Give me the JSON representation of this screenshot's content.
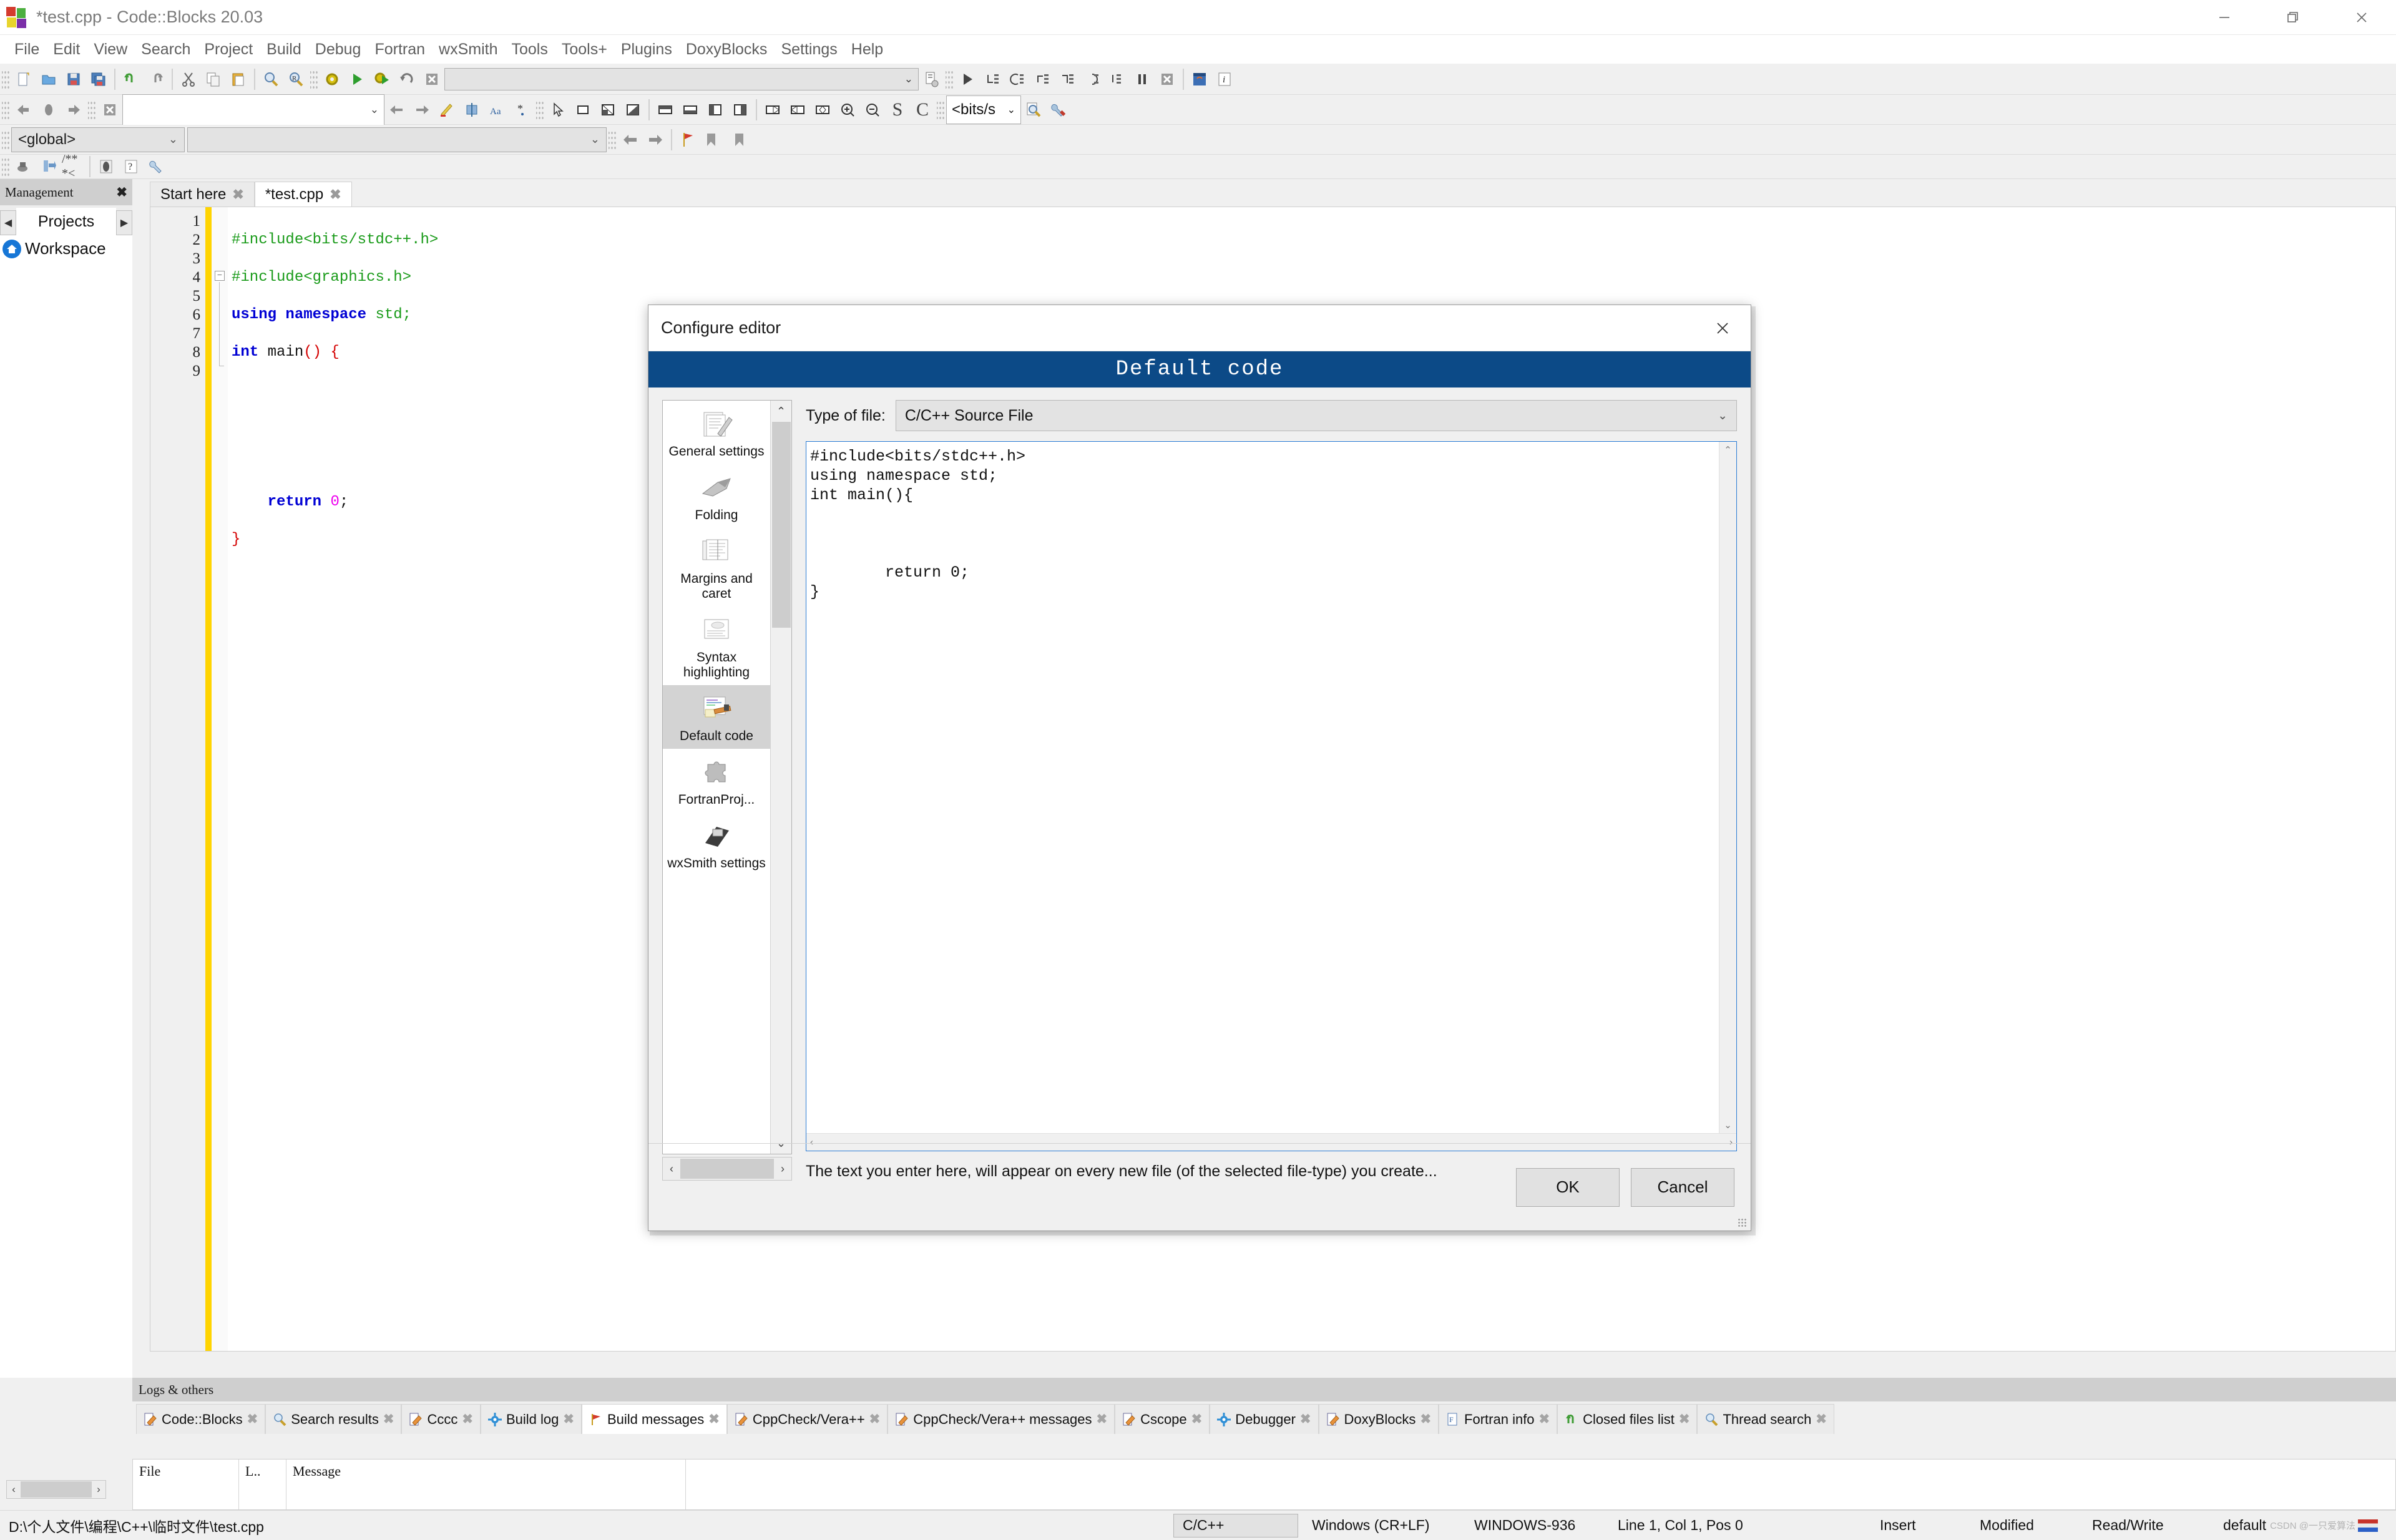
{
  "window": {
    "title": "*test.cpp - Code::Blocks 20.03",
    "logo_icon": "codeblocks-logo-icon",
    "minimize_icon": "minimize-icon",
    "maximize_icon": "restore-icon",
    "close_icon": "close-icon"
  },
  "menubar": {
    "items": [
      "File",
      "Edit",
      "View",
      "Search",
      "Project",
      "Build",
      "Debug",
      "Fortran",
      "wxSmith",
      "Tools",
      "Tools+",
      "Plugins",
      "DoxyBlocks",
      "Settings",
      "Help"
    ]
  },
  "toolbars": {
    "file_group": [
      "new-file-icon",
      "open-file-icon",
      "save-icon",
      "save-all-icon",
      "undo-icon",
      "redo-icon",
      "cut-icon",
      "copy-icon",
      "paste-icon",
      "find-icon",
      "replace-icon"
    ],
    "build_group": [
      "build-icon",
      "run-icon",
      "build-and-run-icon",
      "rebuild-icon",
      "abort-icon"
    ],
    "build_target_value": "",
    "build_target_placeholder": "",
    "build_options_icon": "build-options-icon",
    "debug_group": [
      "debug-continue-icon",
      "next-line-icon",
      "step-into-icon",
      "step-out-icon",
      "next-instruction-icon",
      "step-into-instruction-icon",
      "run-to-cursor-icon",
      "break-debugger-icon",
      "stop-debugger-icon"
    ],
    "debug_extra": [
      "debugging-windows-icon",
      "debugger-info-icon"
    ],
    "nav_group": [
      "back-icon",
      "forward-icon",
      "jump-icon"
    ],
    "browse_clear_icon": "clear-icon",
    "browse_value": "",
    "browse_nav": [
      "previous-icon",
      "next-icon",
      "highlight-icon",
      "toggle-icon",
      "match-case-icon",
      "regex-icon"
    ],
    "wxsmith_group": [
      "pointer-icon",
      "panel-icon",
      "split-v-icon",
      "split-h-icon",
      "dock-top-icon",
      "dock-bottom-icon",
      "dock-left-icon",
      "dock-right-icon",
      "align-left-icon",
      "align-center-icon",
      "align-right-icon",
      "zoom-in-icon",
      "zoom-out-icon"
    ],
    "wxsmith_letters": [
      "S",
      "C"
    ],
    "include_combo_value": "<bits/s",
    "include_icons": [
      "open-include-icon",
      "configure-include-icon"
    ],
    "scope_left_value": "<global>",
    "scope_right_value": "",
    "doxy_group": [
      "doxyblocks-run-icon",
      "doxyblocks-extract-icon",
      "doxyblocks-comment-icon",
      "doxyblocks-block-icon",
      "doxyblocks-help-icon",
      "doxyblocks-config-icon"
    ]
  },
  "management": {
    "header_title": "Management",
    "close_icon": "close-icon",
    "prev_icon": "scroll-left-icon",
    "next_icon": "scroll-right-icon",
    "tab_label": "Projects",
    "workspace_icon": "workspace-home-icon",
    "workspace_label": "Workspace"
  },
  "editor": {
    "tabs": [
      {
        "label": "Start here",
        "active": false,
        "close_icon": "close-icon"
      },
      {
        "label": "*test.cpp",
        "active": true,
        "close_icon": "close-icon"
      }
    ],
    "line_numbers": [
      "1",
      "2",
      "3",
      "4",
      "5",
      "6",
      "7",
      "8",
      "9"
    ],
    "fold_markers": [
      "",
      "",
      "",
      "-",
      "",
      "",
      "",
      "",
      "L"
    ],
    "code_lines": [
      [
        {
          "t": "#include<bits/stdc++.h>",
          "c": "pre"
        }
      ],
      [
        {
          "t": "#include<graphics.h>",
          "c": "pre"
        }
      ],
      [
        {
          "t": "using namespace ",
          "c": "kw"
        },
        {
          "t": "std",
          "c": "green"
        },
        {
          "t": ";",
          "c": "green"
        }
      ],
      [
        {
          "t": "int ",
          "c": "kw"
        },
        {
          "t": "main",
          "c": "id"
        },
        {
          "t": "()",
          "c": "red"
        },
        {
          "t": " {",
          "c": "red"
        }
      ],
      [
        {
          "t": "",
          "c": "id"
        }
      ],
      [
        {
          "t": "",
          "c": "id"
        }
      ],
      [
        {
          "t": "",
          "c": "id"
        }
      ],
      [
        {
          "t": "    ",
          "c": "id"
        },
        {
          "t": "return ",
          "c": "kw"
        },
        {
          "t": "0",
          "c": "num"
        },
        {
          "t": ";",
          "c": "id"
        }
      ],
      [
        {
          "t": "}",
          "c": "red"
        }
      ]
    ]
  },
  "dialog": {
    "title": "Configure editor",
    "close_icon": "close-icon",
    "banner": "Default code",
    "pages": [
      {
        "label": "General settings",
        "icon": "general-settings-icon",
        "selected": false
      },
      {
        "label": "Folding",
        "icon": "folding-icon",
        "selected": false
      },
      {
        "label": "Margins and caret",
        "icon": "margins-caret-icon",
        "selected": false
      },
      {
        "label": "Syntax highlighting",
        "icon": "syntax-highlighting-icon",
        "selected": false
      },
      {
        "label": "Default code",
        "icon": "default-code-icon",
        "selected": true
      },
      {
        "label": "FortranProj...",
        "icon": "fortran-project-icon",
        "selected": false
      },
      {
        "label": "wxSmith settings",
        "icon": "wxsmith-settings-icon",
        "selected": false
      }
    ],
    "list_scroll_up_icon": "chevron-up-icon",
    "list_scroll_down_icon": "chevron-down-icon",
    "list_scroll_left_icon": "chevron-left-icon",
    "list_scroll_right_icon": "chevron-right-icon",
    "type_label": "Type of file:",
    "type_value": "C/C++ Source File",
    "type_dropdown_icon": "chevron-down-icon",
    "code_text": "#include<bits/stdc++.h>\nusing namespace std;\nint main(){\n\n\n\n        return 0;\n}",
    "hint": "The text you enter here, will appear on every new file (of the selected file-type) you create...",
    "ok_label": "OK",
    "cancel_label": "Cancel",
    "banner_color": "#0c4a87"
  },
  "logs": {
    "header_title": "Logs & others",
    "tabs": [
      {
        "label": "Code::Blocks",
        "icon": "pencil-icon",
        "active": false
      },
      {
        "label": "Search results",
        "icon": "magnifier-icon",
        "active": false
      },
      {
        "label": "Cccc",
        "icon": "pencil-icon",
        "active": false
      },
      {
        "label": "Build log",
        "icon": "gear-icon",
        "active": false
      },
      {
        "label": "Build messages",
        "icon": "flag-icon",
        "active": true
      },
      {
        "label": "CppCheck/Vera++",
        "icon": "pencil-icon",
        "active": false
      },
      {
        "label": "CppCheck/Vera++ messages",
        "icon": "pencil-icon",
        "active": false
      },
      {
        "label": "Cscope",
        "icon": "pencil-icon",
        "active": false
      },
      {
        "label": "Debugger",
        "icon": "gear-icon",
        "active": false
      },
      {
        "label": "DoxyBlocks",
        "icon": "pencil-icon",
        "active": false
      },
      {
        "label": "Fortran info",
        "icon": "fortran-icon",
        "active": false
      },
      {
        "label": "Closed files list",
        "icon": "undo-green-icon",
        "active": false
      },
      {
        "label": "Thread search",
        "icon": "magnifier-icon",
        "active": false
      }
    ],
    "close_icon": "close-icon",
    "columns": [
      "File",
      "L..",
      "Message"
    ],
    "rows": []
  },
  "statusbar": {
    "file_path": "D:\\个人文件\\编程\\C++\\临时文件\\test.cpp",
    "language": "C/C++",
    "eol": "Windows (CR+LF)",
    "encoding": "WINDOWS-936",
    "position": "Line 1, Col 1, Pos 0",
    "insert_mode": "Insert",
    "modified": "Modified",
    "access": "Read/Write",
    "profile": "default",
    "watermark": "CSDN @一只爱算法"
  }
}
